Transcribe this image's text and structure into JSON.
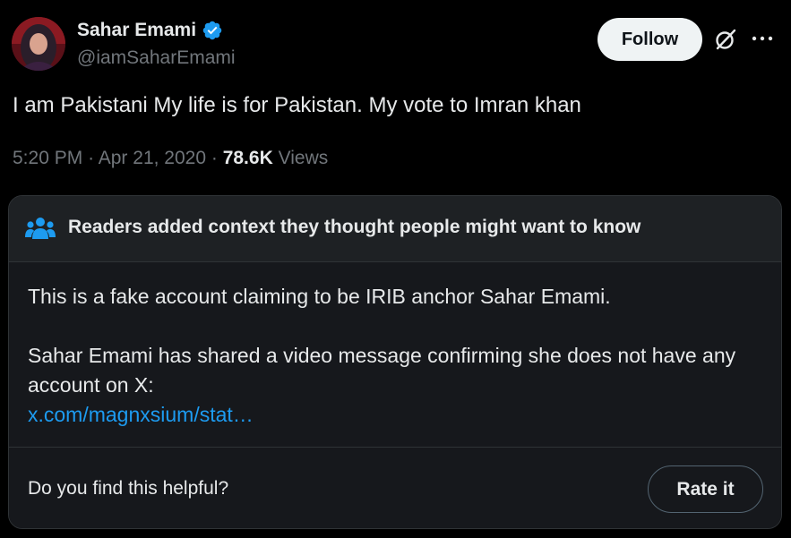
{
  "tweet": {
    "author_name": "Sahar Emami",
    "author_handle": "@iamSaharEmami",
    "verified_icon": "verified-badge-icon",
    "follow_label": "Follow",
    "text": "I am Pakistani My life is for Pakistan. My vote to Imran khan",
    "time": "5:20 PM",
    "date": "Apr 21, 2020",
    "views_count": "78.6K",
    "views_label": "Views",
    "separator": "·"
  },
  "community_note": {
    "header": "Readers added context they thought people might want to know",
    "paragraph_1": "This is a fake account claiming to be IRIB anchor Sahar Emami.",
    "paragraph_2": "Sahar Emami has shared a video message confirming she does not have any account on X:",
    "link_text": "x.com/magnxsium/stat…",
    "helpful_question": "Do you find this helpful?",
    "rate_label": "Rate it"
  },
  "colors": {
    "background": "#000000",
    "text": "#e7e9ea",
    "secondary_text": "#71767b",
    "link": "#1d9bf0",
    "verified": "#1d9bf0",
    "note_icon": "#1d9bf0"
  }
}
